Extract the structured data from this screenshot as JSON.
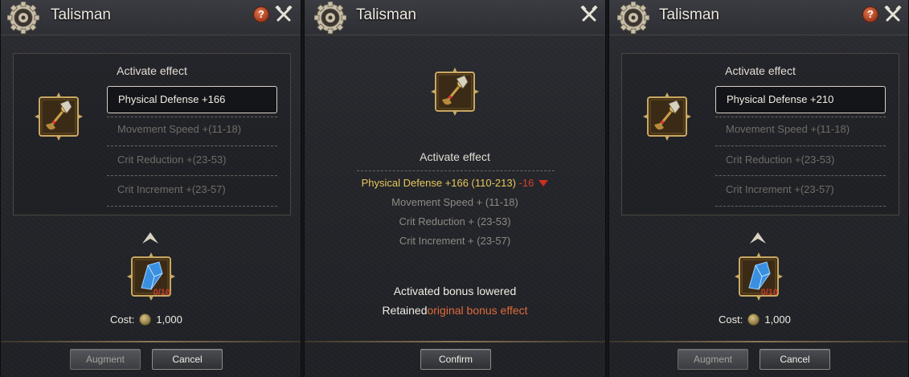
{
  "title": "Talisman",
  "box_header": "Activate effect",
  "options_left": [
    {
      "label": "Physical Defense +166",
      "selected": true
    },
    {
      "label": "Movement Speed +(11-18)",
      "selected": false
    },
    {
      "label": "Crit Reduction +(23-53)",
      "selected": false
    },
    {
      "label": "Crit Increment +(23-57)",
      "selected": false
    }
  ],
  "options_right": [
    {
      "label": "Physical Defense +210",
      "selected": true
    },
    {
      "label": "Movement Speed +(11-18)",
      "selected": false
    },
    {
      "label": "Crit Reduction +(23-53)",
      "selected": false
    },
    {
      "label": "Crit Increment +(23-57)",
      "selected": false
    }
  ],
  "material_count": "0/10",
  "cost": {
    "label": "Cost:",
    "value": "1,000"
  },
  "buttons": {
    "augment": "Augment",
    "cancel": "Cancel",
    "confirm": "Confirm"
  },
  "result": {
    "header": "Activate effect",
    "primary": "Physical Defense +166 (110-213)",
    "delta": "-16",
    "others": [
      "Movement Speed + (11-18)",
      "Crit Reduction + (23-53)",
      "Crit Increment + (23-57)"
    ],
    "notice_line1": "Activated bonus lowered",
    "notice_prefix": "Retained",
    "notice_highlight": "original bonus effect"
  },
  "icons": [
    "gear-icon",
    "help-icon",
    "tools-icon",
    "talisman-icon",
    "up-arrow-icon",
    "crystal-icon",
    "coin-icon",
    "down-arrow-icon"
  ],
  "colors": {
    "gold": "#e8c65a",
    "red": "#d4432e",
    "orange": "#e06a3b",
    "help": "#c2532c"
  }
}
